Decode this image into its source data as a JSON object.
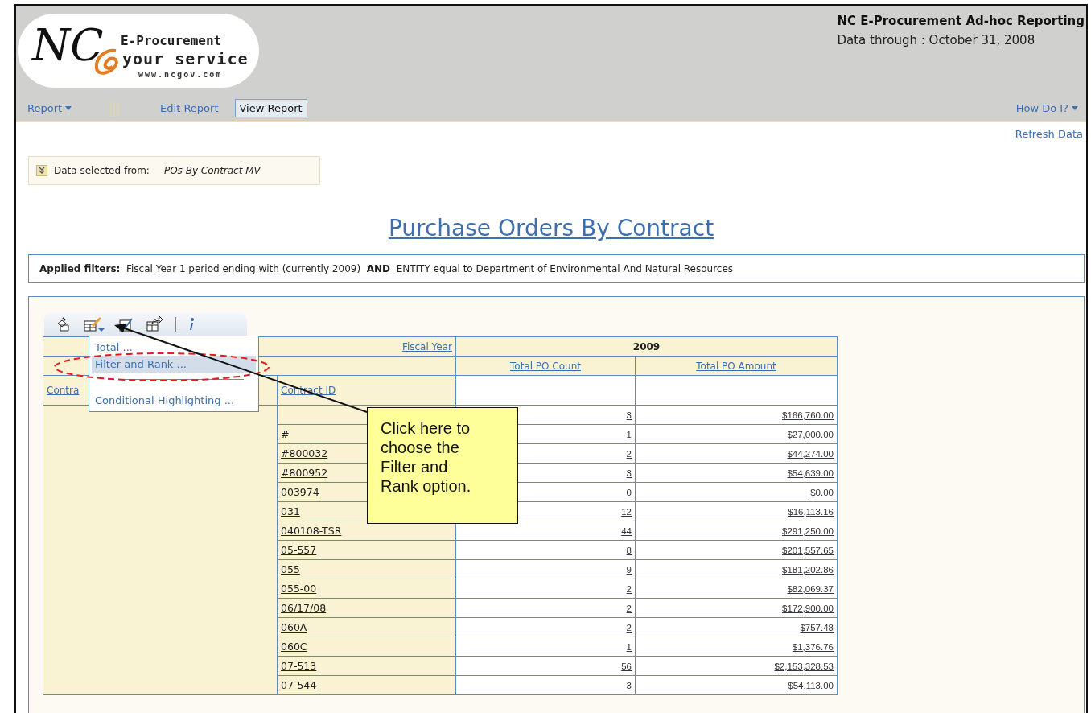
{
  "logo": {
    "mark": "NC",
    "line1": "E-Procurement",
    "line2": "your service",
    "url": "www.ncgov.com"
  },
  "app_title": "NC E-Procurement Ad-hoc Reporting",
  "data_through": "Data through : October 31, 2008",
  "nav": [
    {
      "label": "Report",
      "kind": "menu",
      "selected": false
    },
    {
      "label": "Edit Report",
      "kind": "tab",
      "selected": false
    },
    {
      "label": "View Report",
      "kind": "tab",
      "selected": true
    }
  ],
  "help_menu": "How Do I?",
  "refresh_link": "Refresh Data",
  "data_source": {
    "label": "Data selected from:",
    "value": "POs By Contract MV"
  },
  "report_title": "Purchase Orders By Contract",
  "applied_filters": "**Applied filters:**  Fiscal Year 1 period ending with (currently 2009)  **AND**  ENTITY equal to Department of Environmental And Natural Resources",
  "menu": [
    {
      "kind": "item",
      "label": "Total ...",
      "selected": false
    },
    {
      "kind": "item",
      "label": "Filter and Rank ...",
      "selected": true
    },
    {
      "kind": "separator"
    },
    {
      "kind": "item",
      "label": "Conditional Highlighting ...",
      "selected": false
    }
  ],
  "table": {
    "fiscal_year_label": "Fiscal Year",
    "year": "2009",
    "columns": [
      "Contra",
      "Contract ID",
      "Total PO Count",
      "Total PO Amount"
    ],
    "rows": [
      {
        "contract_id": "",
        "count": "3",
        "amount": "$166,760.00"
      },
      {
        "contract_id": "#",
        "count": "1",
        "amount": "$27,000.00"
      },
      {
        "contract_id": "#800032",
        "count": "2",
        "amount": "$44,274.00"
      },
      {
        "contract_id": "#800952",
        "count": "3",
        "amount": "$54,639.00"
      },
      {
        "contract_id": "003974",
        "count": "0",
        "amount": "$0.00"
      },
      {
        "contract_id": "031",
        "count": "12",
        "amount": "$16,113.16"
      },
      {
        "contract_id": "040108-TSR",
        "count": "44",
        "amount": "$291,250.00"
      },
      {
        "contract_id": "05-557",
        "count": "8",
        "amount": "$201,557.65"
      },
      {
        "contract_id": "055",
        "count": "9",
        "amount": "$181,202.86"
      },
      {
        "contract_id": "055-00",
        "count": "2",
        "amount": "$82,069.37"
      },
      {
        "contract_id": "06/17/08",
        "count": "2",
        "amount": "$172,900.00"
      },
      {
        "contract_id": "060A",
        "count": "2",
        "amount": "$757.48"
      },
      {
        "contract_id": "060C",
        "count": "1",
        "amount": "$1,376.76"
      },
      {
        "contract_id": "07-513",
        "count": "56",
        "amount": "$2,153,328.53"
      },
      {
        "contract_id": "07-544",
        "count": "3",
        "amount": "$54,113.00"
      }
    ]
  },
  "callout": "Click here to choose the Filter and Rank option."
}
